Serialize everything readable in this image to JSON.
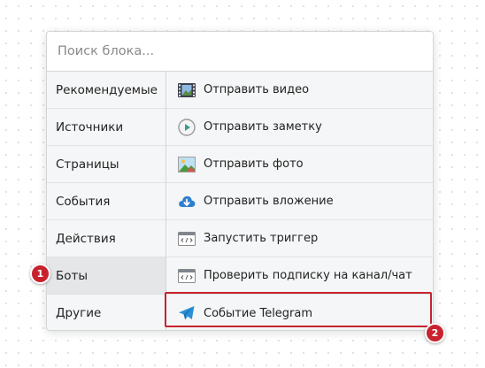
{
  "search": {
    "placeholder": "Поиск блока..."
  },
  "categories": [
    {
      "label": "Рекомендуемые"
    },
    {
      "label": "Источники"
    },
    {
      "label": "Страницы"
    },
    {
      "label": "События"
    },
    {
      "label": "Действия"
    },
    {
      "label": "Боты",
      "active": true
    },
    {
      "label": "Другие"
    }
  ],
  "blocks": [
    {
      "label": "Отправить видео",
      "icon": "video-film-icon"
    },
    {
      "label": "Отправить заметку",
      "icon": "play-circle-icon"
    },
    {
      "label": "Отправить фото",
      "icon": "photo-icon"
    },
    {
      "label": "Отправить вложение",
      "icon": "cloud-download-icon"
    },
    {
      "label": "Запустить триггер",
      "icon": "code-window-icon"
    },
    {
      "label": "Проверить подписку на канал/чат",
      "icon": "code-window-icon"
    },
    {
      "label": "Событие Telegram",
      "icon": "telegram-plane-icon"
    }
  ],
  "annotations": {
    "badge_1": "1",
    "badge_2": "2",
    "highlight_color": "#c8222e"
  }
}
